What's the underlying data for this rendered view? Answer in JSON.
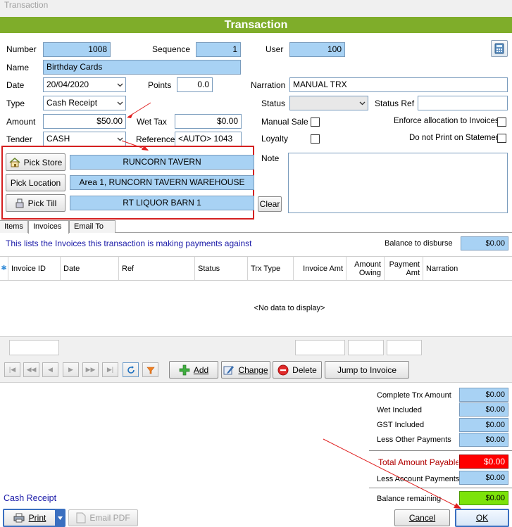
{
  "window": {
    "title": "Transaction"
  },
  "header": {
    "title": "Transaction"
  },
  "fields": {
    "number_label": "Number",
    "number": "1008",
    "sequence_label": "Sequence",
    "sequence": "1",
    "user_label": "User",
    "user": "100",
    "name_label": "Name",
    "name": "Birthday Cards",
    "date_label": "Date",
    "date": "20/04/2020",
    "points_label": "Points",
    "points": "0.0",
    "narration_label": "Narration",
    "narration": "MANUAL TRX",
    "type_label": "Type",
    "type": "Cash Receipt",
    "status_label": "Status",
    "status": "",
    "status_ref_label": "Status Ref",
    "status_ref": "",
    "amount_label": "Amount",
    "amount": "$50.00",
    "wet_tax_label": "Wet Tax",
    "wet_tax": "$0.00",
    "manual_sale_label": "Manual Sale",
    "enforce_label": "Enforce allocation to Invoices",
    "tender_label": "Tender",
    "tender": "CASH",
    "reference_label": "Reference",
    "reference": "<AUTO> 1043",
    "loyalty_label": "Loyalty",
    "do_not_print_label": "Do not Print on Statement",
    "note_label": "Note",
    "note": ""
  },
  "pickers": {
    "store_button": "Pick Store",
    "store": "RUNCORN TAVERN",
    "location_button": "Pick Location",
    "location": "Area 1, RUNCORN TAVERN WAREHOUSE",
    "till_button": "Pick Till",
    "till": "RT LIQUOR BARN 1",
    "clear_button": "Clear"
  },
  "tabs": [
    "Items",
    "Invoices",
    "Email To"
  ],
  "invoices": {
    "info": "This lists the Invoices this transaction is making payments against",
    "balance_label": "Balance to disburse",
    "balance": "$0.00",
    "columns": [
      "Invoice ID",
      "Date",
      "Ref",
      "Status",
      "Trx Type",
      "Invoice Amt",
      "Amount Owing",
      "Payment Amt",
      "Narration"
    ],
    "empty_text": "<No data to display>"
  },
  "toolbar": {
    "add": "Add",
    "change": "Change",
    "delete": "Delete",
    "jump": "Jump to Invoice"
  },
  "summary": {
    "complete_label": "Complete Trx Amount",
    "complete": "$0.00",
    "wet_label": "Wet Included",
    "wet": "$0.00",
    "gst_label": "GST Included",
    "gst": "$0.00",
    "less_other_label": "Less Other Payments",
    "less_other": "$0.00",
    "total_label": "Total Amount Payable",
    "total": "$0.00",
    "less_account_label": "Less Account Payments",
    "less_account": "$0.00",
    "balance_label": "Balance remaining",
    "balance": "$0.00"
  },
  "footer": {
    "type_label": "Cash Receipt",
    "print": "Print",
    "email_pdf": "Email PDF",
    "cancel": "Cancel",
    "ok": "OK"
  },
  "colors": {
    "header": "#7fad2a",
    "field_blue": "#a8d2f4",
    "highlight_red": "#e02020",
    "total_red_bg": "#ff0000",
    "balance_green": "#7ce30a",
    "link_blue": "#1a1aa8"
  },
  "icons": [
    "calculator-icon",
    "home-icon",
    "till-icon",
    "chevron-down-icon",
    "plus-icon",
    "edit-icon",
    "delete-icon",
    "refresh-icon",
    "filter-icon",
    "printer-icon",
    "pdf-icon"
  ]
}
